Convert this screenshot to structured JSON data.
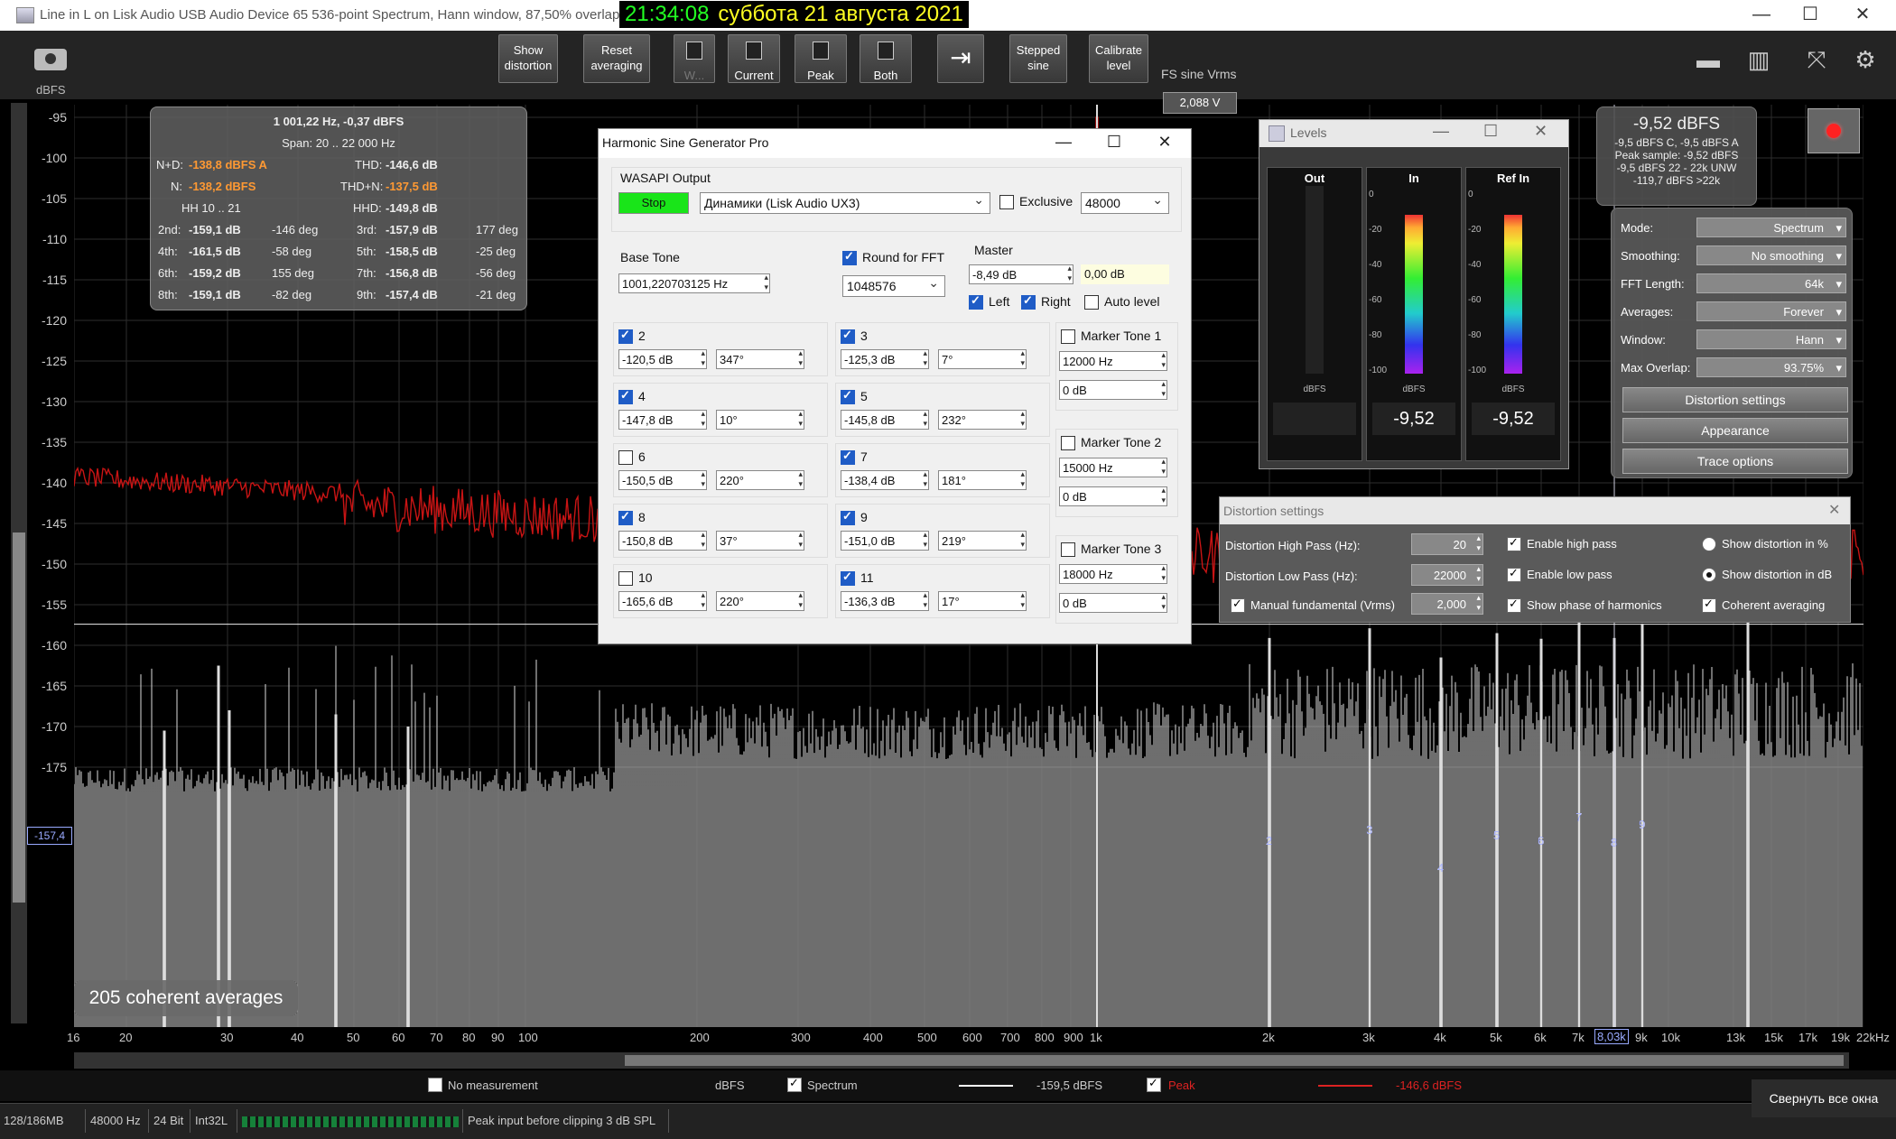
{
  "window": {
    "title": "Line in L on Lisk Audio USB Audio Device 65 536-point Spectrum, Hann window, 87,50% overlap,",
    "time": "21:34:08",
    "date": "суббота 21 августа 2021",
    "min": "—",
    "max": "☐",
    "close": "✕"
  },
  "toolbar": {
    "show_distortion": "Show\ndistortion",
    "reset_averaging": "Reset\naveraging",
    "w": "W...",
    "current": "Current",
    "peak": "Peak",
    "both": "Both",
    "stepped_sine": "Stepped\nsine",
    "calibrate_level": "Calibrate\nlevel",
    "fs_sine_label": "FS sine Vrms",
    "fs_sine_value": "2,088 V",
    "y_unit": "dBFS"
  },
  "plot": {
    "y_ticks": [
      "-95",
      "-100",
      "-105",
      "-110",
      "-115",
      "-120",
      "-125",
      "-130",
      "-135",
      "-140",
      "-145",
      "-150",
      "-155",
      "-160",
      "-165",
      "-170",
      "-175"
    ],
    "x_ticks": [
      "16",
      "20",
      "30",
      "40",
      "50",
      "60",
      "70",
      "80",
      "90",
      "100",
      "200",
      "300",
      "400",
      "500",
      "600",
      "700",
      "800",
      "900",
      "1k",
      "2k",
      "3k",
      "4k",
      "5k",
      "6k",
      "7k",
      "9k",
      "10k",
      "13k",
      "15k",
      "17k",
      "19k",
      "22kHz"
    ],
    "x_cursor": "8,03k",
    "hline_label": "-157,4",
    "harmonic_labels": [
      "2",
      "3",
      "4",
      "5",
      "6",
      "7",
      "8",
      "9"
    ],
    "averages": "205 coherent averages"
  },
  "info": {
    "freq": "1 001,22 Hz, -0,37 dBFS",
    "span": "Span: 20 .. 22 000 Hz",
    "nd_label": "N+D:",
    "nd_value": "-138,8 dBFS A",
    "thd_label": "THD:",
    "thd_value": "-146,6 dB",
    "n_label": "N:",
    "n_value": "-138,2 dBFS",
    "thdn_label": "THD+N:",
    "thdn_value": "-137,5 dB",
    "hh_label": "HH 10 .. 21",
    "hhd_label": "HHD:",
    "hhd_value": "-149,8 dB",
    "rows": [
      {
        "l1": "2nd:",
        "v1": "-159,1 dB",
        "d1": "-146 deg",
        "l2": "3rd:",
        "v2": "-157,9 dB",
        "d2": "177 deg"
      },
      {
        "l1": "4th:",
        "v1": "-161,5 dB",
        "d1": "-58 deg",
        "l2": "5th:",
        "v2": "-158,5 dB",
        "d2": "-25 deg"
      },
      {
        "l1": "6th:",
        "v1": "-159,2 dB",
        "d1": "155 deg",
        "l2": "7th:",
        "v2": "-156,8 dB",
        "d2": "-56 deg"
      },
      {
        "l1": "8th:",
        "v1": "-159,1 dB",
        "d1": "-82 deg",
        "l2": "9th:",
        "v2": "-157,4 dB",
        "d2": "-21 deg"
      }
    ]
  },
  "generator": {
    "title": "Harmonic Sine Generator Pro",
    "min": "—",
    "max": "☐",
    "close": "✕",
    "output_label": "WASAPI Output",
    "stop": "Stop",
    "device": "Динамики (Lisk Audio UX3)",
    "exclusive": "Exclusive",
    "rate": "48000",
    "base_tone_label": "Base Tone",
    "base_tone": "1001,220703125 Hz",
    "round_fft": "Round for FFT",
    "fft_size": "1048576",
    "master_label": "Master",
    "master_db": "-8,49 dB",
    "master_level": "0,00 dB",
    "left": "Left",
    "right": "Right",
    "auto_level": "Auto level",
    "harmonics": [
      {
        "n": "2",
        "db": "-120,5 dB",
        "ph": "347°",
        "on": true
      },
      {
        "n": "3",
        "db": "-125,3 dB",
        "ph": "7°",
        "on": true
      },
      {
        "n": "4",
        "db": "-147,8 dB",
        "ph": "10°",
        "on": true
      },
      {
        "n": "5",
        "db": "-145,8 dB",
        "ph": "232°",
        "on": true
      },
      {
        "n": "6",
        "db": "-150,5 dB",
        "ph": "220°",
        "on": false
      },
      {
        "n": "7",
        "db": "-138,4 dB",
        "ph": "181°",
        "on": true
      },
      {
        "n": "8",
        "db": "-150,8 dB",
        "ph": "37°",
        "on": true
      },
      {
        "n": "9",
        "db": "-151,0 dB",
        "ph": "219°",
        "on": true
      },
      {
        "n": "10",
        "db": "-165,6 dB",
        "ph": "220°",
        "on": false
      },
      {
        "n": "11",
        "db": "-136,3 dB",
        "ph": "17°",
        "on": true
      }
    ],
    "markers": [
      {
        "label": "Marker Tone 1",
        "freq": "12000 Hz",
        "db": "0 dB"
      },
      {
        "label": "Marker Tone 2",
        "freq": "15000 Hz",
        "db": "0 dB"
      },
      {
        "label": "Marker Tone 3",
        "freq": "18000 Hz",
        "db": "0 dB"
      }
    ]
  },
  "levels": {
    "title": "Levels",
    "out": "Out",
    "in": "In",
    "ref_in": "Ref In",
    "unit": "dBFS",
    "in_value": "-9,52",
    "ref_value": "-9,52",
    "axis": [
      "0",
      "-20",
      "-40",
      "-60",
      "-80",
      "-100"
    ]
  },
  "peak": {
    "main": "-9,52 dBFS",
    "l1": "-9,5 dBFS C, -9,5 dBFS A",
    "l2": "Peak sample: -9,52 dBFS",
    "l3": "-9,5 dBFS 22 - 22k UNW",
    "l4": "-119,7 dBFS >22k"
  },
  "settings": {
    "mode_label": "Mode:",
    "mode": "Spectrum",
    "smoothing_label": "Smoothing:",
    "smoothing": "No  smoothing",
    "fft_label": "FFT Length:",
    "fft": "64k",
    "averages_label": "Averages:",
    "averages": "Forever",
    "window_label": "Window:",
    "window": "Hann",
    "overlap_label": "Max Overlap:",
    "overlap": "93.75%",
    "btn_distortion": "Distortion settings",
    "btn_appearance": "Appearance",
    "btn_trace": "Trace options"
  },
  "dist": {
    "title": "Distortion settings",
    "close": "✕",
    "hp_label": "Distortion High Pass (Hz):",
    "hp": "20",
    "lp_label": "Distortion Low Pass (Hz):",
    "lp": "22000",
    "manual_label": "Manual fundamental (Vrms)",
    "manual": "2,000",
    "enable_hp": "Enable high pass",
    "enable_lp": "Enable low pass",
    "show_phase": "Show phase of harmonics",
    "show_pct": "Show distortion in %",
    "show_db": "Show distortion in dB",
    "coherent": "Coherent averaging"
  },
  "legend": {
    "no_measurement": "No measurement",
    "unit": "dBFS",
    "spectrum": "Spectrum",
    "spectrum_value": "-159,5 dBFS",
    "peak": "Peak",
    "peak_value": "-146,6 dBFS"
  },
  "status": {
    "mem": "128/186MB",
    "rate": "48000 Hz",
    "bits": "24 Bit",
    "fmt": "Int32L",
    "clip": "Peak input before clipping 3 dB SPL",
    "tooltip": "Свернуть все окна"
  },
  "colors": {
    "background": "#000000",
    "grid": "#2e2e2e",
    "peak_trace": "#c81414",
    "spectrum_trace": "#d8d8d8",
    "harmonic_label": "#aab4ff",
    "stop_green": "#19e519"
  }
}
